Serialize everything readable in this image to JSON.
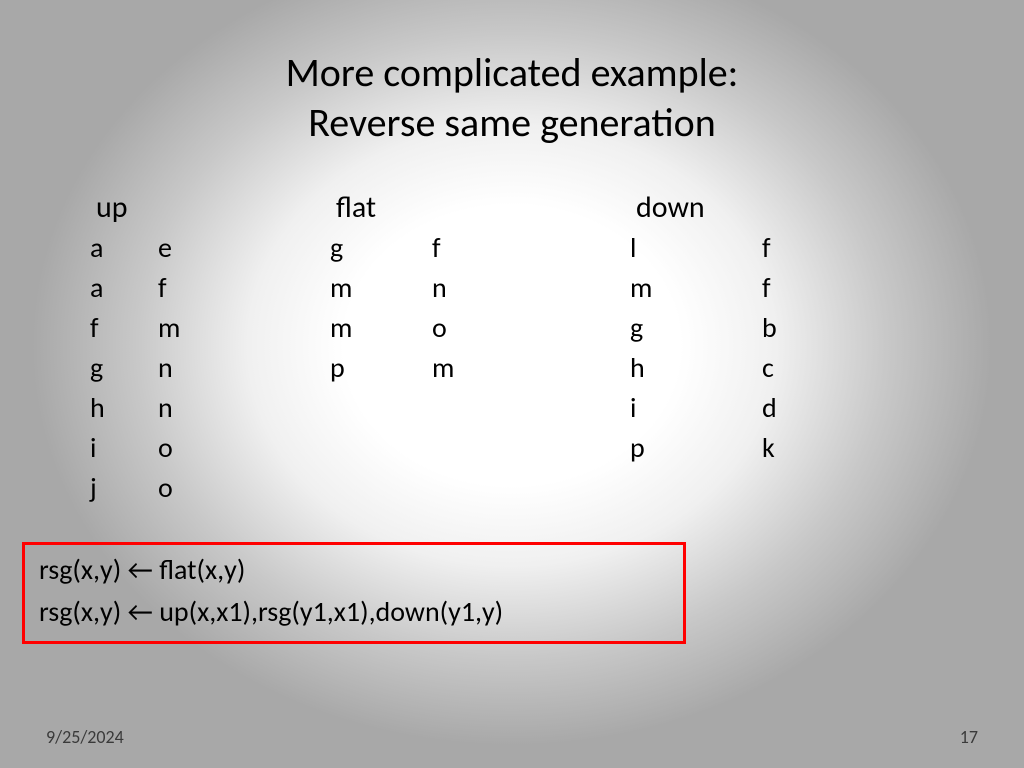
{
  "title": {
    "line1": "More complicated example:",
    "line2": "Reverse same generation"
  },
  "columns": {
    "up": {
      "header": "up",
      "rows": [
        [
          "a",
          "e"
        ],
        [
          "a",
          "f"
        ],
        [
          "f",
          "m"
        ],
        [
          "g",
          "n"
        ],
        [
          "h",
          "n"
        ],
        [
          "i",
          "o"
        ],
        [
          "j",
          "o"
        ]
      ]
    },
    "flat": {
      "header": "flat",
      "rows": [
        [
          "g",
          "f"
        ],
        [
          "m",
          "n"
        ],
        [
          "m",
          "o"
        ],
        [
          "p",
          "m"
        ]
      ]
    },
    "down": {
      "header": "down",
      "rows": [
        [
          "l",
          "f"
        ],
        [
          "m",
          "f"
        ],
        [
          "g",
          "b"
        ],
        [
          "h",
          "c"
        ],
        [
          "i",
          "d"
        ],
        [
          "p",
          "k"
        ]
      ]
    }
  },
  "rules": {
    "line1": "rsg(x,y) ← flat(x,y)",
    "line2": "rsg(x,y) ← up(x,x1),rsg(y1,x1),down(y1,y)"
  },
  "footer": {
    "date": "9/25/2024",
    "page": "17"
  }
}
